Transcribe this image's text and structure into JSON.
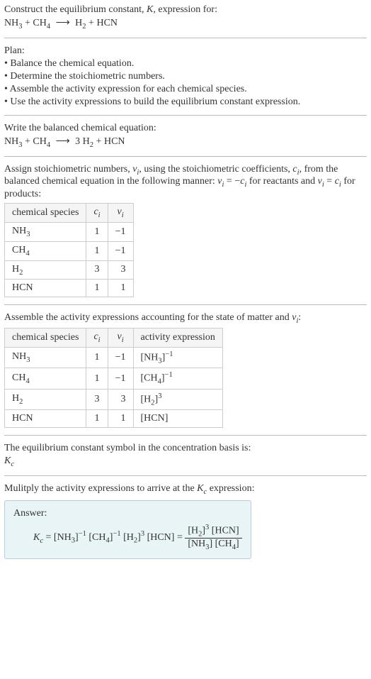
{
  "intro": {
    "line1_pre": "Construct the equilibrium constant, ",
    "line1_K": "K",
    "line1_post": ", expression for:"
  },
  "eq_unbalanced": {
    "reactants": [
      {
        "base": "NH",
        "sub": "3"
      },
      {
        "base": "CH",
        "sub": "4"
      }
    ],
    "products": [
      {
        "base": "H",
        "sub": "2"
      },
      {
        "base": "HCN",
        "sub": ""
      }
    ],
    "plus": " + ",
    "arrow": "⟶"
  },
  "plan": {
    "heading": "Plan:",
    "items": [
      "Balance the chemical equation.",
      "Determine the stoichiometric numbers.",
      "Assemble the activity expression for each chemical species.",
      "Use the activity expressions to build the equilibrium constant expression."
    ]
  },
  "balanced_heading": "Write the balanced chemical equation:",
  "eq_balanced": {
    "reactants": [
      {
        "coef": "",
        "base": "NH",
        "sub": "3"
      },
      {
        "coef": "",
        "base": "CH",
        "sub": "4"
      }
    ],
    "products": [
      {
        "coef": "3 ",
        "base": "H",
        "sub": "2"
      },
      {
        "coef": "",
        "base": "HCN",
        "sub": ""
      }
    ],
    "plus": " + ",
    "arrow": "⟶"
  },
  "stoich_text": {
    "seg1": "Assign stoichiometric numbers, ",
    "nu_i": "ν",
    "nu_i_sub": "i",
    "seg2": ", using the stoichiometric coefficients, ",
    "c_i": "c",
    "c_i_sub": "i",
    "seg3": ", from the balanced chemical equation in the following manner: ",
    "eq1_lhs": "ν",
    "eq1_lhs_sub": "i",
    "eq1_mid": " = −",
    "eq1_rhs": "c",
    "eq1_rhs_sub": "i",
    "seg4": " for reactants and ",
    "eq2_lhs": "ν",
    "eq2_lhs_sub": "i",
    "eq2_mid": " = ",
    "eq2_rhs": "c",
    "eq2_rhs_sub": "i",
    "seg5": " for products:"
  },
  "table1": {
    "headers": {
      "species": "chemical species",
      "ci": "c",
      "ci_sub": "i",
      "nui": "ν",
      "nui_sub": "i"
    },
    "rows": [
      {
        "base": "NH",
        "sub": "3",
        "ci": "1",
        "nui": "−1"
      },
      {
        "base": "CH",
        "sub": "4",
        "ci": "1",
        "nui": "−1"
      },
      {
        "base": "H",
        "sub": "2",
        "ci": "3",
        "nui": "3"
      },
      {
        "base": "HCN",
        "sub": "",
        "ci": "1",
        "nui": "1"
      }
    ]
  },
  "activity_text": {
    "seg1": "Assemble the activity expressions accounting for the state of matter and ",
    "nu": "ν",
    "nu_sub": "i",
    "seg2": ":"
  },
  "table2": {
    "headers": {
      "species": "chemical species",
      "ci": "c",
      "ci_sub": "i",
      "nui": "ν",
      "nui_sub": "i",
      "act": "activity expression"
    },
    "rows": [
      {
        "base": "NH",
        "sub": "3",
        "ci": "1",
        "nui": "−1",
        "act_base": "NH",
        "act_sub": "3",
        "act_sup": "−1"
      },
      {
        "base": "CH",
        "sub": "4",
        "ci": "1",
        "nui": "−1",
        "act_base": "CH",
        "act_sub": "4",
        "act_sup": "−1"
      },
      {
        "base": "H",
        "sub": "2",
        "ci": "3",
        "nui": "3",
        "act_base": "H",
        "act_sub": "2",
        "act_sup": "3"
      },
      {
        "base": "HCN",
        "sub": "",
        "ci": "1",
        "nui": "1",
        "act_base": "HCN",
        "act_sub": "",
        "act_sup": ""
      }
    ]
  },
  "kc_text": {
    "line1": "The equilibrium constant symbol in the concentration basis is:",
    "K": "K",
    "K_sub": "c"
  },
  "multiply_text": {
    "seg1": "Mulitply the activity expressions to arrive at the ",
    "K": "K",
    "K_sub": "c",
    "seg2": " expression:"
  },
  "answer": {
    "label": "Answer:",
    "K": "K",
    "K_sub": "c",
    "eq": " = ",
    "terms": [
      {
        "base": "NH",
        "sub": "3",
        "sup": "−1"
      },
      {
        "base": "CH",
        "sub": "4",
        "sup": "−1"
      },
      {
        "base": "H",
        "sub": "2",
        "sup": "3"
      },
      {
        "base": "HCN",
        "sub": "",
        "sup": ""
      }
    ],
    "eq2": " = ",
    "num": [
      {
        "base": "H",
        "sub": "2",
        "sup": "3"
      },
      {
        "base": "HCN",
        "sub": "",
        "sup": ""
      }
    ],
    "den": [
      {
        "base": "NH",
        "sub": "3",
        "sup": ""
      },
      {
        "base": "CH",
        "sub": "4",
        "sup": ""
      }
    ]
  }
}
